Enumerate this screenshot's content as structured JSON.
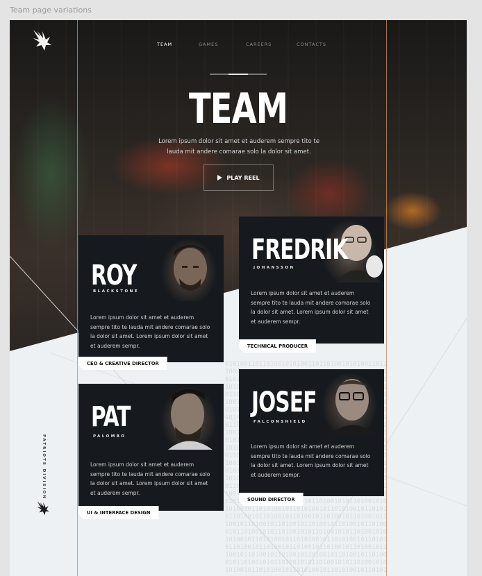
{
  "caption": "Team page variations",
  "nav": [
    {
      "label": "TEAM",
      "active": true
    },
    {
      "label": "GAMES",
      "active": false
    },
    {
      "label": "CAREERS",
      "active": false
    },
    {
      "label": "CONTACTS",
      "active": false
    }
  ],
  "hero": {
    "title": "TEAM",
    "description": "Lorem ipsum dolor sit amet et auderem sempre tito te lauda mit andere comarae solo la dolor sit amet.",
    "play_label": "PLAY REEL"
  },
  "sidebar": {
    "vertical_text": "PATRIOTS DIVISION"
  },
  "team": [
    {
      "first": "ROY",
      "last": "BLACKSTONE",
      "description": "Lorem ipsum dolor sit amet et auderem sempre tito te lauda mit andere comarae solo la dolor sit amet. Lorem ipsum dolor sit amet et auderem sempr.",
      "role": "CEO & CREATIVE DIRECTOR"
    },
    {
      "first": "FREDRIK",
      "last": "JOHANSSON",
      "description": "Lorem ipsum dolor sit amet et auderem sempre tito te lauda mit andere comarae solo la dolor sit amet. Lorem ipsum dolor sit amet et auderem sempr.",
      "role": "TECHNICAL PRODUCER"
    },
    {
      "first": "PAT",
      "last": "PALOMBO",
      "description": "Lorem ipsum dolor sit amet et auderem sempre tito te lauda mit andere comarae solo la dolor sit amet. Lorem ipsum dolor sit amet et auderem sempr.",
      "role": "UI & INTERFACE DESIGN"
    },
    {
      "first": "JOSEF",
      "last": "FALCONSHIELD",
      "description": "Lorem ipsum dolor sit amet et auderem sempre tito te lauda mit andere comarae solo la dolor sit amet. Lorem ipsum dolor sit amet et auderem sempr.",
      "role": "SOUND DIRECTOR"
    }
  ],
  "colors": {
    "accent_line": "#c98a62",
    "card_bg": "#161a1e",
    "page_bg": "#eef1f4"
  },
  "icons": [
    "eagle-logo-icon",
    "play-icon"
  ]
}
